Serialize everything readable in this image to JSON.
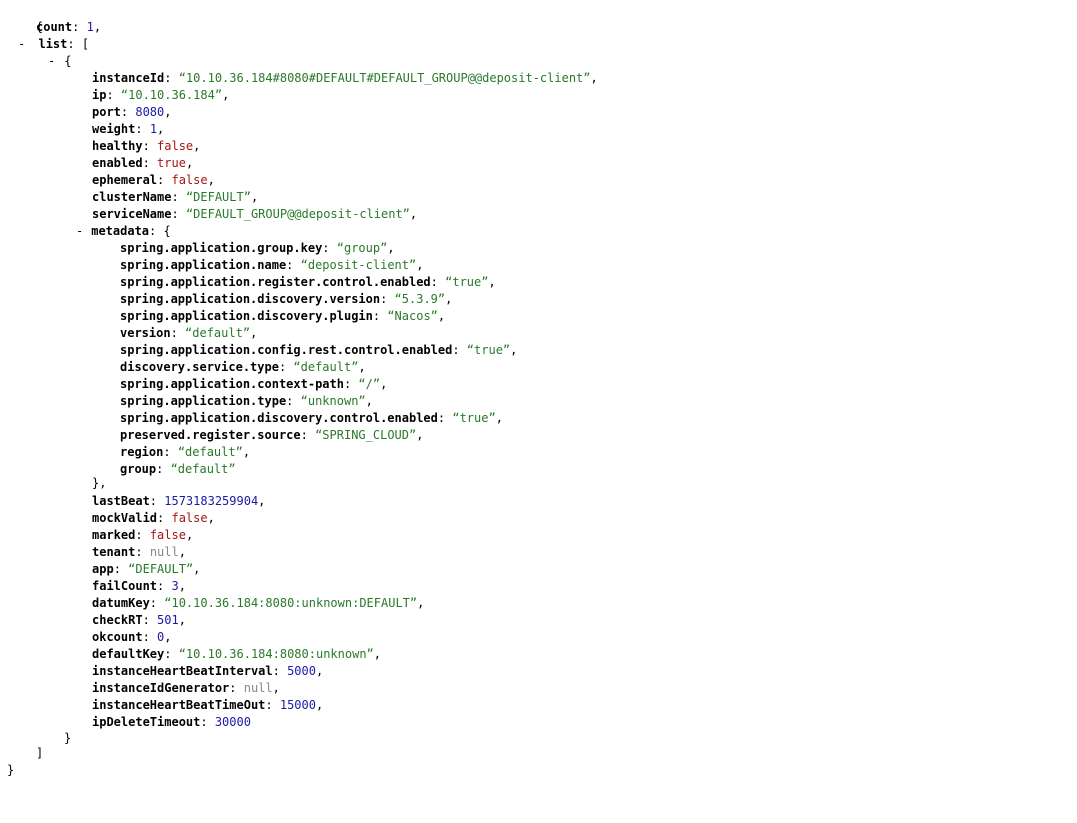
{
  "glyphs": {
    "collapse": "-",
    "open_brace": "{",
    "close_brace": "}",
    "open_bracket": "[",
    "close_bracket": "]",
    "colon": ": ",
    "comma": ","
  },
  "root_keys": {
    "count": "count",
    "list": "list"
  },
  "count_value": "1",
  "item": {
    "instanceId": {
      "key": "instanceId",
      "value": "“10.10.36.184#8080#DEFAULT#DEFAULT_GROUP@@deposit-client”"
    },
    "ip": {
      "key": "ip",
      "value": "“10.10.36.184”"
    },
    "port": {
      "key": "port",
      "value": "8080"
    },
    "weight": {
      "key": "weight",
      "value": "1"
    },
    "healthy": {
      "key": "healthy",
      "value": "false"
    },
    "enabled": {
      "key": "enabled",
      "value": "true"
    },
    "ephemeral": {
      "key": "ephemeral",
      "value": "false"
    },
    "clusterName": {
      "key": "clusterName",
      "value": "“DEFAULT”"
    },
    "serviceName": {
      "key": "serviceName",
      "value": "“DEFAULT_GROUP@@deposit-client”"
    },
    "metadata_key": "metadata",
    "metadata": [
      {
        "key": "spring.application.group.key",
        "value": "“group”"
      },
      {
        "key": "spring.application.name",
        "value": "“deposit-client”"
      },
      {
        "key": "spring.application.register.control.enabled",
        "value": "“true”"
      },
      {
        "key": "spring.application.discovery.version",
        "value": "“5.3.9”"
      },
      {
        "key": "spring.application.discovery.plugin",
        "value": "“Nacos”"
      },
      {
        "key": "version",
        "value": "“default”"
      },
      {
        "key": "spring.application.config.rest.control.enabled",
        "value": "“true”"
      },
      {
        "key": "discovery.service.type",
        "value": "“default”"
      },
      {
        "key": "spring.application.context-path",
        "value": "“/”"
      },
      {
        "key": "spring.application.type",
        "value": "“unknown”"
      },
      {
        "key": "spring.application.discovery.control.enabled",
        "value": "“true”"
      },
      {
        "key": "preserved.register.source",
        "value": "“SPRING_CLOUD”"
      },
      {
        "key": "region",
        "value": "“default”"
      },
      {
        "key": "group",
        "value": "“default”"
      }
    ],
    "rest": [
      {
        "key": "lastBeat",
        "value": "1573183259904",
        "type": "num"
      },
      {
        "key": "mockValid",
        "value": "false",
        "type": "bool"
      },
      {
        "key": "marked",
        "value": "false",
        "type": "bool"
      },
      {
        "key": "tenant",
        "value": "null",
        "type": "null"
      },
      {
        "key": "app",
        "value": "“DEFAULT”",
        "type": "str"
      },
      {
        "key": "failCount",
        "value": "3",
        "type": "num"
      },
      {
        "key": "datumKey",
        "value": "“10.10.36.184:8080:unknown:DEFAULT”",
        "type": "str"
      },
      {
        "key": "checkRT",
        "value": "501",
        "type": "num"
      },
      {
        "key": "okcount",
        "value": "0",
        "type": "num"
      },
      {
        "key": "defaultKey",
        "value": "“10.10.36.184:8080:unknown”",
        "type": "str"
      },
      {
        "key": "instanceHeartBeatInterval",
        "value": "5000",
        "type": "num"
      },
      {
        "key": "instanceIdGenerator",
        "value": "null",
        "type": "null"
      },
      {
        "key": "instanceHeartBeatTimeOut",
        "value": "15000",
        "type": "num"
      },
      {
        "key": "ipDeleteTimeout",
        "value": "30000",
        "type": "num"
      }
    ]
  },
  "colors": {
    "key": "#000000",
    "string": "#2a7a2a",
    "number": "#1a1aa6",
    "boolean": "#a31515",
    "null": "#888888",
    "background": "#ffffff"
  }
}
